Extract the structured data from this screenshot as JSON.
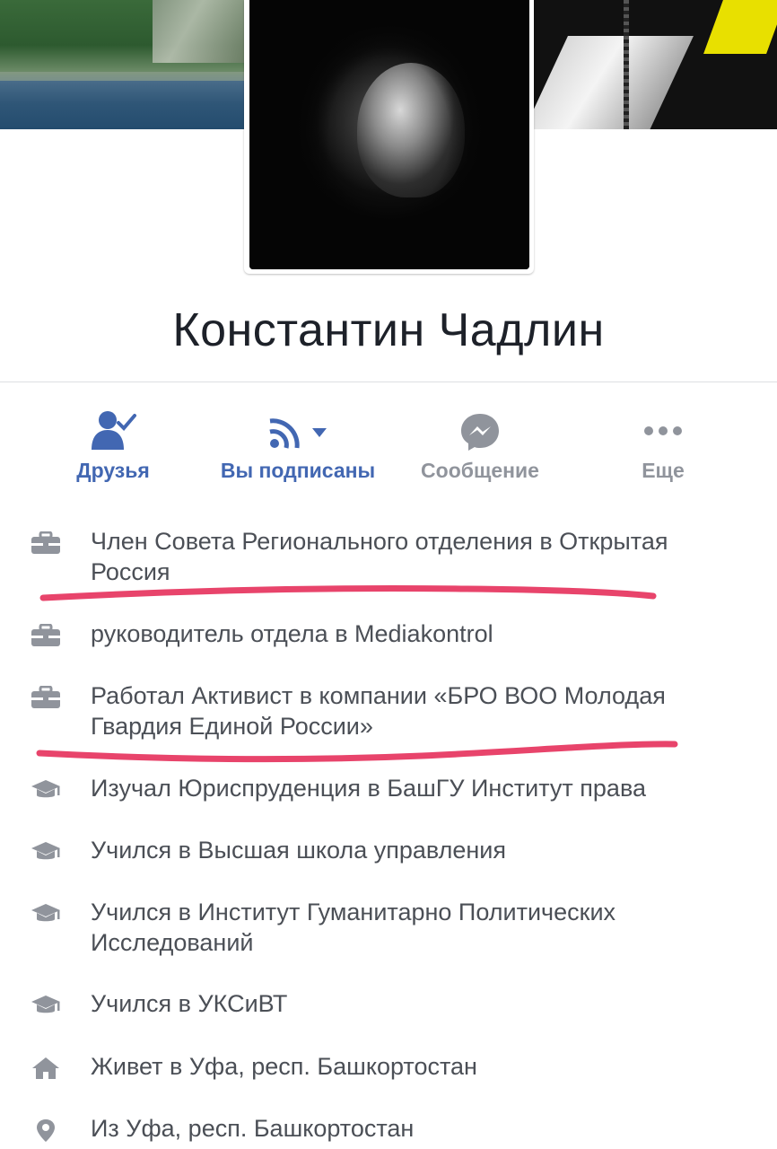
{
  "profile": {
    "name": "Константин Чадлин"
  },
  "actions": [
    {
      "label": "Друзья",
      "icon": "friends-check-icon",
      "color": "#4267b2"
    },
    {
      "label": "Вы подписаны",
      "icon": "rss-follow-icon",
      "color": "#4267b2"
    },
    {
      "label": "Сообщение",
      "icon": "messenger-icon",
      "color": "#90949c"
    },
    {
      "label": "Еще",
      "icon": "more-dots-icon",
      "color": "#90949c"
    }
  ],
  "info": [
    {
      "icon": "briefcase-icon",
      "text": "Член Совета Регионального отделения в Открытая Россия"
    },
    {
      "icon": "briefcase-icon",
      "text": "руководитель отдела в Mediakontrol"
    },
    {
      "icon": "briefcase-icon",
      "text": "Работал Активист в компании «БРО ВОО Молодая Гвардия Единой России»"
    },
    {
      "icon": "graduation-cap-icon",
      "text": "Изучал Юриспруденция в БашГУ Институт права"
    },
    {
      "icon": "graduation-cap-icon",
      "text": "Учился в Высшая школа управления"
    },
    {
      "icon": "graduation-cap-icon",
      "text": "Учился в Институт Гуманитарно Политических Исследований"
    },
    {
      "icon": "graduation-cap-icon",
      "text": "Учился в УКСиВТ"
    },
    {
      "icon": "home-icon",
      "text": "Живет в Уфа, респ. Башкортостан"
    },
    {
      "icon": "location-pin-icon",
      "text": "Из Уфа, респ. Башкортостан"
    }
  ],
  "colors": {
    "accent": "#4267b2",
    "muted": "#90949c",
    "annotation": "#e8446b"
  }
}
